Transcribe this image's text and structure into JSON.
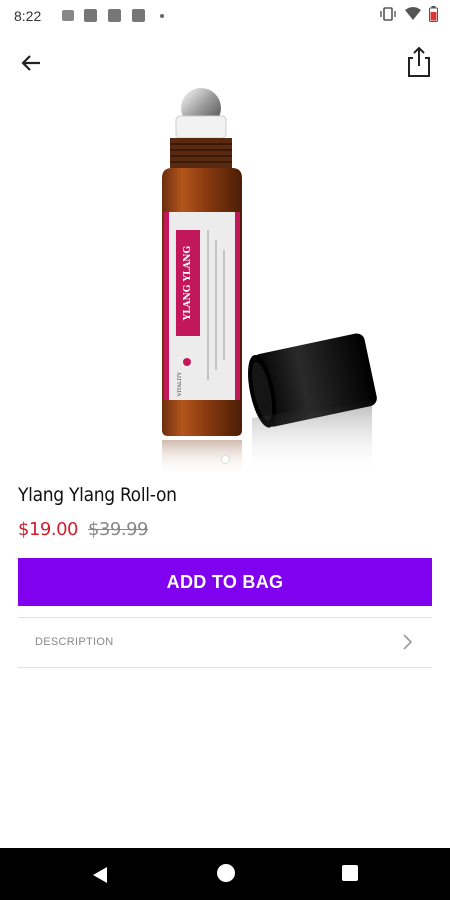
{
  "status_bar": {
    "time": "8:22"
  },
  "product": {
    "title": "Ylang Ylang Roll-on",
    "sale_price": "$19.00",
    "original_price": "$39.99",
    "image_label_text": "YLANG YLANG",
    "image_brand_text": "VITALITY",
    "carousel_active_index": 1,
    "carousel_count": 1
  },
  "actions": {
    "add_to_bag": "ADD TO BAG"
  },
  "sections": {
    "description": "DESCRIPTION"
  },
  "icons": {
    "back": "arrow-left-icon",
    "share": "share-icon",
    "chevron": "chevron-right-icon"
  },
  "colors": {
    "accent": "#8000f0",
    "sale_price": "#d0202e",
    "label_pink": "#c2185b"
  }
}
